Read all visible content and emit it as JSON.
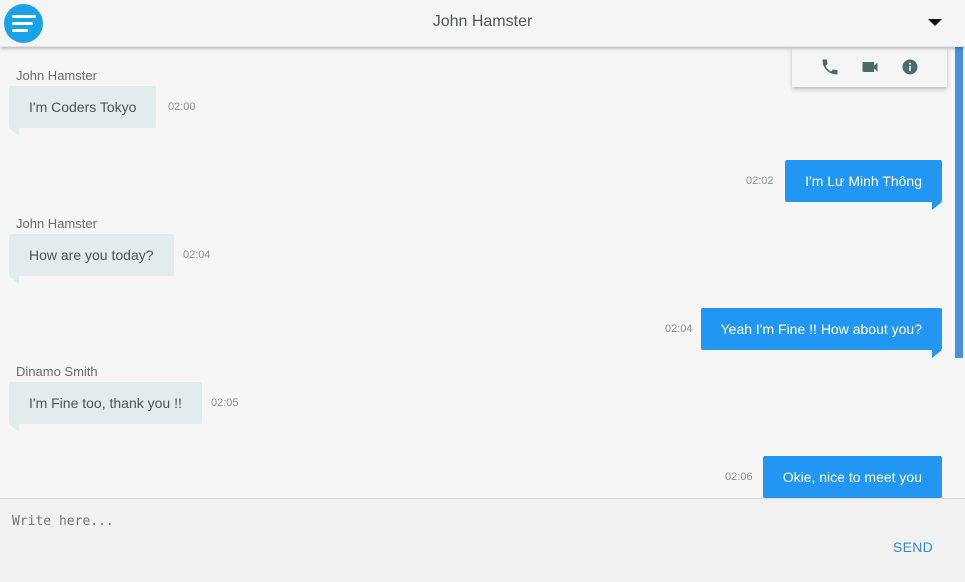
{
  "header": {
    "title": "John Hamster"
  },
  "actions": {
    "icons": [
      "phone-icon",
      "video-camera-icon",
      "info-icon"
    ]
  },
  "messages": [
    {
      "direction": "in",
      "sender": "John Hamster",
      "text": "I'm Coders Tokyo",
      "time": "02:00"
    },
    {
      "direction": "out",
      "sender": "",
      "text": "I'm Lư Minh Thông",
      "time": "02:02"
    },
    {
      "direction": "in",
      "sender": "John Hamster",
      "text": "How are you today?",
      "time": "02:04"
    },
    {
      "direction": "out",
      "sender": "",
      "text": "Yeah I'm Fine !! How about you?",
      "time": "02:04"
    },
    {
      "direction": "in",
      "sender": "Dinamo Smith",
      "text": "I'm Fine too, thank you !!",
      "time": "02:05"
    },
    {
      "direction": "out",
      "sender": "",
      "text": "Okie, nice to meet you",
      "time": "02:06"
    }
  ],
  "composer": {
    "placeholder": "Write here...",
    "value": "",
    "send_label": "SEND"
  },
  "colors": {
    "accent": "#19a2e8",
    "outgoing_bubble": "#2196f3",
    "incoming_bubble": "#e2ecec",
    "send": "#2f8ad8"
  }
}
